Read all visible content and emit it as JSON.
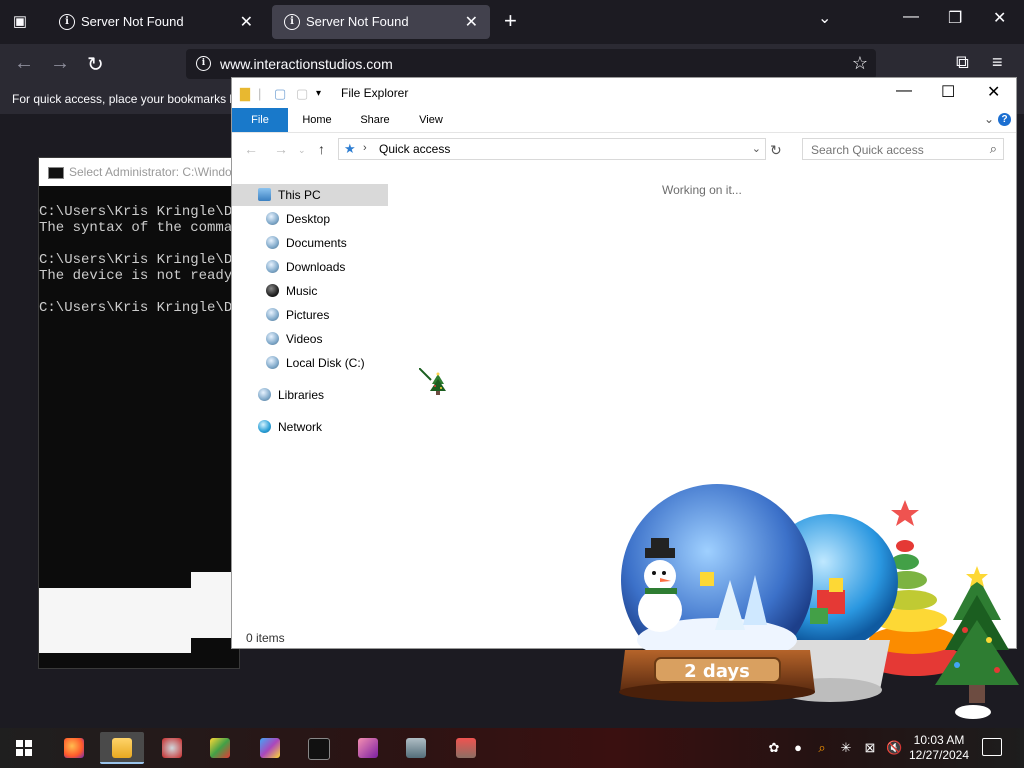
{
  "browser": {
    "tabs": [
      {
        "title": "Server Not Found",
        "active": false
      },
      {
        "title": "Server Not Found",
        "active": true
      }
    ],
    "url": "www.interactionstudios.com",
    "bookmarks_hint": "For quick access, place your bookmarks h"
  },
  "cmd": {
    "title": "Select Administrator: C:\\Windo",
    "lines": [
      "C:\\Users\\Kris Kringle\\De",
      "The syntax of the comman",
      "",
      "C:\\Users\\Kris Kringle\\De",
      "The device is not ready.",
      "",
      "C:\\Users\\Kris Kringle\\De"
    ]
  },
  "explorer": {
    "title": "File Explorer",
    "ribbon_tabs": [
      "File",
      "Home",
      "Share",
      "View"
    ],
    "address_crumb": "Quick access",
    "search_placeholder": "Search Quick access",
    "nav": {
      "this_pc": "This PC",
      "pc_items": [
        "Desktop",
        "Documents",
        "Downloads",
        "Music",
        "Pictures",
        "Videos",
        "Local Disk (C:)"
      ],
      "libraries": "Libraries",
      "network": "Network"
    },
    "working_text": "Working on it...",
    "status_text": "0 items"
  },
  "decorations": {
    "globe_counter_text": "2 days"
  },
  "taskbar": {
    "time": "10:03 AM",
    "date": "12/27/2024"
  },
  "colors": {
    "firefox_tab_bg": "#1c1b22",
    "firefox_active_tab": "#42414d",
    "explorer_file_tab": "#1979ca",
    "selection": "#cde8ff"
  }
}
